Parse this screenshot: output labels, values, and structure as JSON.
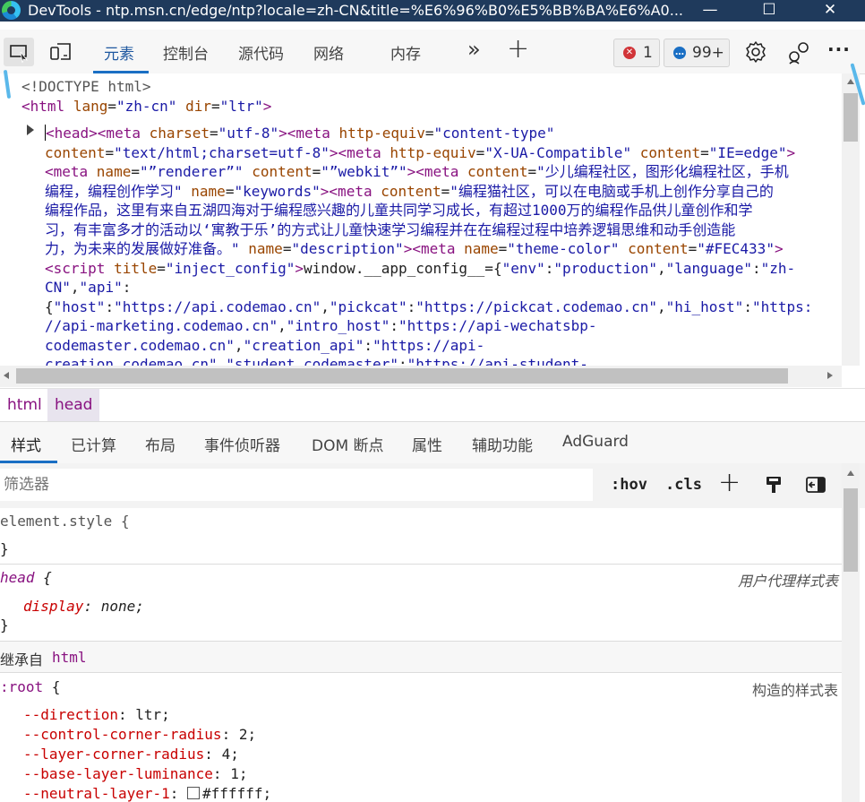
{
  "window": {
    "title": "DevTools - ntp.msn.cn/edge/ntp?locale=zh-CN&title=%E6%96%B0%E5%BB%BA%E6%A0...",
    "minimize": "—",
    "maximize": "☐",
    "close": "✕"
  },
  "toolbar": {
    "tabs": [
      "元素",
      "控制台",
      "源代码",
      "网络",
      "内存"
    ],
    "more_tabs": "»",
    "add_tab": "+",
    "errors_count": "1",
    "messages_count": "99+",
    "more": "···"
  },
  "elements": {
    "doctype": "<!DOCTYPE html>",
    "html_line": {
      "open": "<html",
      "attr1": "lang",
      "val1": "\"zh-cn\"",
      "attr2": "dir",
      "val2": "\"ltr\"",
      "close": ">"
    },
    "head_lines": [
      [
        [
          "tag",
          "<head>"
        ],
        [
          "tag",
          "<meta "
        ],
        [
          "attr",
          "charset"
        ],
        [
          "txt",
          "="
        ],
        [
          "val",
          "\"utf-8\""
        ],
        [
          "tag",
          ">"
        ],
        [
          "tag",
          "<meta "
        ],
        [
          "attr",
          "http-equiv"
        ],
        [
          "txt",
          "="
        ],
        [
          "val",
          "\"content-type\""
        ]
      ],
      [
        [
          "attr",
          "content"
        ],
        [
          "txt",
          "="
        ],
        [
          "val",
          "\"text/html;charset=utf-8\""
        ],
        [
          "tag",
          ">"
        ],
        [
          "tag",
          "<meta "
        ],
        [
          "attr",
          "http-equiv"
        ],
        [
          "txt",
          "="
        ],
        [
          "val",
          "\"X-UA-Compatible\""
        ],
        [
          "txt",
          " "
        ],
        [
          "attr",
          "content"
        ],
        [
          "txt",
          "="
        ],
        [
          "val",
          "\"IE=edge\""
        ],
        [
          "tag",
          ">"
        ]
      ],
      [
        [
          "tag",
          "<meta "
        ],
        [
          "attr",
          "name"
        ],
        [
          "txt",
          "="
        ],
        [
          "val",
          "\"”renderer”\""
        ],
        [
          "txt",
          " "
        ],
        [
          "attr",
          "content"
        ],
        [
          "txt",
          "="
        ],
        [
          "val",
          "\"”webkit”\""
        ],
        [
          "tag",
          ">"
        ],
        [
          "tag",
          "<meta "
        ],
        [
          "attr",
          "content"
        ],
        [
          "txt",
          "="
        ],
        [
          "val",
          "\"少儿编程社区，图形化编程社区，手机"
        ]
      ],
      [
        [
          "val",
          "编程，编程创作学习\""
        ],
        [
          "txt",
          " "
        ],
        [
          "attr",
          "name"
        ],
        [
          "txt",
          "="
        ],
        [
          "val",
          "\"keywords\""
        ],
        [
          "tag",
          ">"
        ],
        [
          "tag",
          "<meta "
        ],
        [
          "attr",
          "content"
        ],
        [
          "txt",
          "="
        ],
        [
          "val",
          "\"编程猫社区，可以在电脑或手机上创作分享自己的"
        ]
      ],
      [
        [
          "val",
          "编程作品，这里有来自五湖四海对于编程感兴趣的儿童共同学习成长，有超过1000万的编程作品供儿童创作和学"
        ]
      ],
      [
        [
          "val",
          "习，有丰富多才的活动以‘寓教于乐’的方式让儿童快速学习编程并在在编程过程中培养逻辑思维和动手创造能"
        ]
      ],
      [
        [
          "val",
          "力，为未来的发展做好准备。\""
        ],
        [
          "txt",
          " "
        ],
        [
          "attr",
          "name"
        ],
        [
          "txt",
          "="
        ],
        [
          "val",
          "\"description\""
        ],
        [
          "tag",
          ">"
        ],
        [
          "tag",
          "<meta "
        ],
        [
          "attr",
          "name"
        ],
        [
          "txt",
          "="
        ],
        [
          "val",
          "\"theme-color\""
        ],
        [
          "txt",
          " "
        ],
        [
          "attr",
          "content"
        ],
        [
          "txt",
          "="
        ],
        [
          "val",
          "\"#FEC433\""
        ],
        [
          "tag",
          ">"
        ]
      ],
      [
        [
          "tag",
          "<script "
        ],
        [
          "attr",
          "title"
        ],
        [
          "txt",
          "="
        ],
        [
          "val",
          "\"inject_config\""
        ],
        [
          "tag",
          ">"
        ],
        [
          "txt",
          "window.__app_config__={"
        ],
        [
          "val",
          "\"env\""
        ],
        [
          "txt",
          ":"
        ],
        [
          "val",
          "\"production\""
        ],
        [
          "txt",
          ","
        ],
        [
          "val",
          "\"language\""
        ],
        [
          "txt",
          ":"
        ],
        [
          "val",
          "\"zh-"
        ]
      ],
      [
        [
          "val",
          "CN\""
        ],
        [
          "txt",
          ","
        ],
        [
          "val",
          "\"api\""
        ],
        [
          "txt",
          ":"
        ]
      ],
      [
        [
          "txt",
          "{"
        ],
        [
          "val",
          "\"host\""
        ],
        [
          "txt",
          ":"
        ],
        [
          "val",
          "\"https://api.codemao.cn\""
        ],
        [
          "txt",
          ","
        ],
        [
          "val",
          "\"pickcat\""
        ],
        [
          "txt",
          ":"
        ],
        [
          "val",
          "\"https://pickcat.codemao.cn\""
        ],
        [
          "txt",
          ","
        ],
        [
          "val",
          "\"hi_host\""
        ],
        [
          "txt",
          ":"
        ],
        [
          "val",
          "\"https:"
        ]
      ],
      [
        [
          "val",
          "//api-marketing.codemao.cn\""
        ],
        [
          "txt",
          ","
        ],
        [
          "val",
          "\"intro_host\""
        ],
        [
          "txt",
          ":"
        ],
        [
          "val",
          "\"https://api-wechatsbp-"
        ]
      ],
      [
        [
          "val",
          "codemaster.codemao.cn\""
        ],
        [
          "txt",
          ","
        ],
        [
          "val",
          "\"creation_api\""
        ],
        [
          "txt",
          ":"
        ],
        [
          "val",
          "\"https://api-"
        ]
      ],
      [
        [
          "val",
          "creation.codemao.cn\""
        ],
        [
          "txt",
          ","
        ],
        [
          "val",
          "\"student_codemaster\""
        ],
        [
          "txt",
          ":"
        ],
        [
          "val",
          "\"https://api-student-"
        ]
      ]
    ]
  },
  "breadcrumb": [
    "html",
    "head"
  ],
  "styles_tabs": [
    "样式",
    "已计算",
    "布局",
    "事件侦听器",
    "DOM 断点",
    "属性",
    "辅助功能",
    "AdGuard"
  ],
  "filter": {
    "placeholder": "筛选器",
    "hov": ":hov",
    "cls": ".cls",
    "plus": "+"
  },
  "styles": {
    "element_style": "element.style {",
    "close_brace": "}",
    "head_rule": {
      "selector": "head",
      "open": " {",
      "origin": "用户代理样式表",
      "prop": "display",
      "value": "none;"
    },
    "inherited_label": "继承自",
    "inherited_from": "html",
    "root_rule": {
      "selector": ":root",
      "open": " {",
      "origin": "构造的样式表",
      "props": [
        {
          "name": "--direction",
          "value": "ltr;"
        },
        {
          "name": "--control-corner-radius",
          "value": "2;"
        },
        {
          "name": "--layer-corner-radius",
          "value": "4;"
        },
        {
          "name": "--base-layer-luminance",
          "value": "1;"
        },
        {
          "name": "--neutral-layer-1",
          "value": "#ffffff;"
        }
      ]
    }
  },
  "colors": {
    "title_bar": "#1f3a5c",
    "accent": "#1a6fc4",
    "tag": "#881280",
    "attribute": "#994500",
    "value": "#1a1aa6",
    "error_badge": "#d13438",
    "message_badge": "#1a6fc4"
  },
  "icons": [
    "edge-logo-icon",
    "inspect-icon",
    "device-emulation-icon",
    "settings-gear-icon",
    "customize-icon",
    "more-icon",
    "new-rule-icon",
    "paint-icon",
    "sidebar-toggle-icon"
  ]
}
